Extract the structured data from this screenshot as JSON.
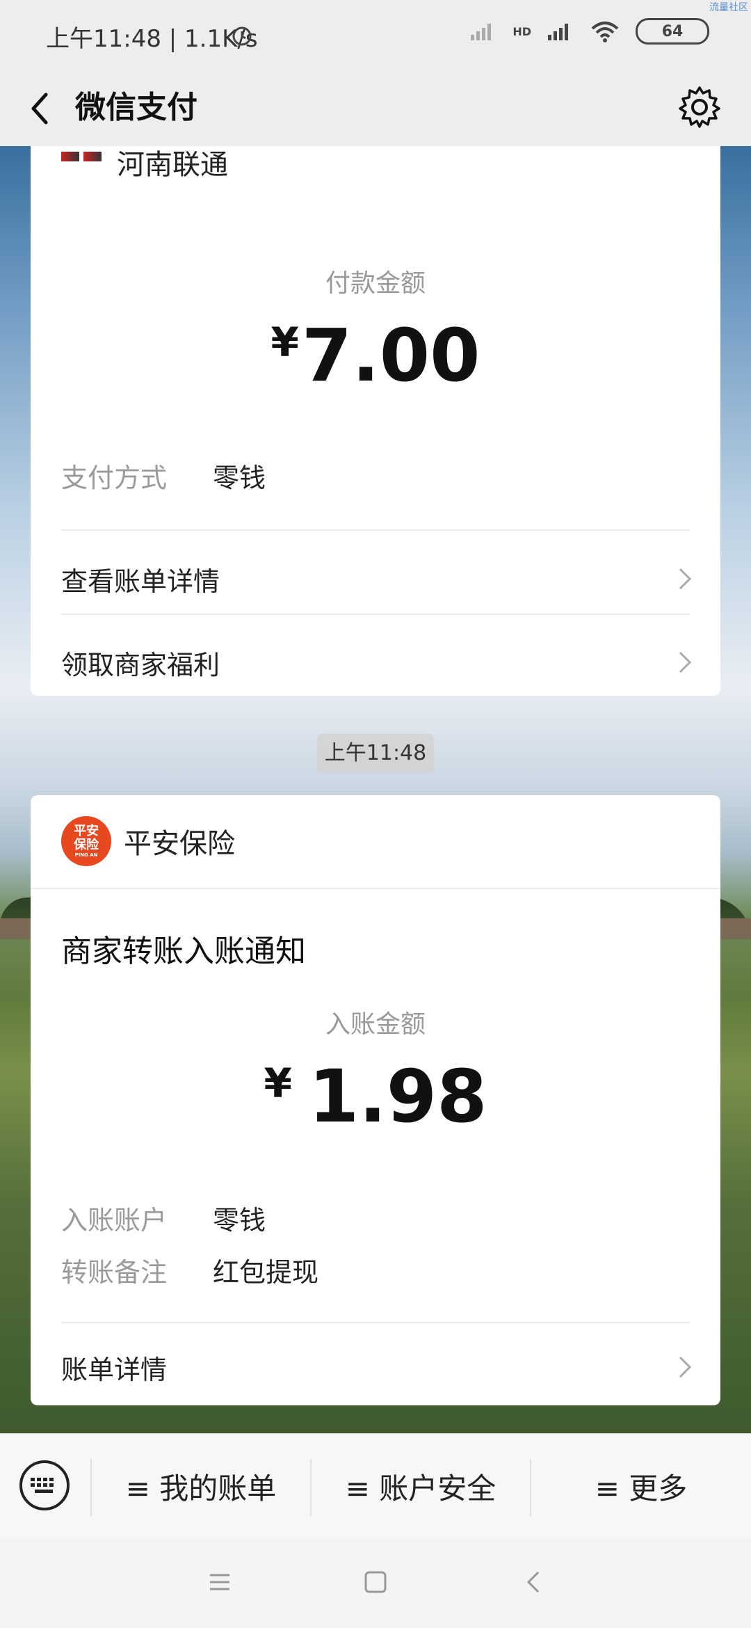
{
  "status_bar": {
    "time_info": "上午11:48 | 1.1K/s",
    "network": "HD",
    "battery": "64",
    "corner_tag": "流量社区"
  },
  "nav": {
    "title": "微信支付"
  },
  "card1": {
    "merchant_name": "河南联通",
    "amount_label": "付款金额",
    "currency": "¥",
    "amount": "7.00",
    "payment_method_key": "支付方式",
    "payment_method_value": "零钱",
    "link_bill_details": "查看账单详情",
    "link_merchant_benefits": "领取商家福利"
  },
  "time_chip": "上午11:48",
  "card2": {
    "merchant_name": "平安保险",
    "logo_text_top": "平安",
    "logo_text_bottom": "保险",
    "logo_sub": "PING AN",
    "title": "商家转账入账通知",
    "amount_label": "入账金额",
    "currency": "¥",
    "amount": "1.98",
    "account_key": "入账账户",
    "account_value": "零钱",
    "note_key": "转账备注",
    "note_value": "红包提现",
    "link_bill_details": "账单详情"
  },
  "bottom_menu": {
    "items": [
      "≡ 我的账单",
      "≡ 账户安全",
      "≡ 更多"
    ]
  },
  "colors": {
    "accent_red": "#e8481f",
    "header_bg": "#ededed",
    "card_bg": "#ffffff"
  }
}
